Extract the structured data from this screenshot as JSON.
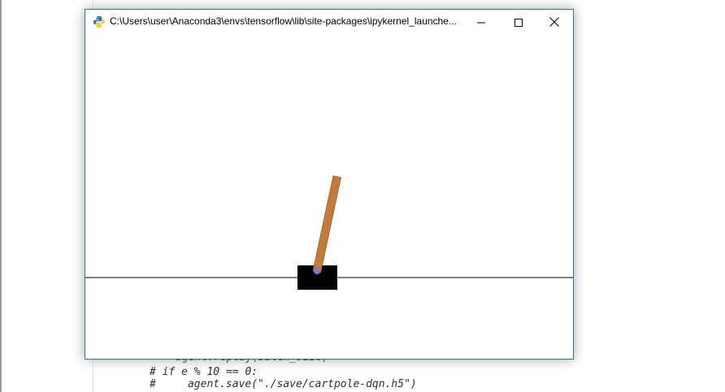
{
  "window": {
    "title": "C:\\Users\\user\\Anaconda3\\envs\\tensorflow\\lib\\site-packages\\ipykernel_launche...",
    "icon": "python-icon",
    "controls": {
      "minimize": "minimize-icon",
      "maximize": "maximize-icon",
      "close": "close-icon"
    }
  },
  "cartpole": {
    "track_color": "#000000",
    "cart_color": "#000000",
    "pole_color": "#c47a3a",
    "axle_color": "#7a7ad0",
    "pole_angle_deg": 12
  },
  "editor": {
    "lines": [
      "    agent.replay(batch_size)",
      "# if e % 10 == 0:",
      "#     agent.save(\"./save/cartpole-dqn.h5\")"
    ]
  }
}
